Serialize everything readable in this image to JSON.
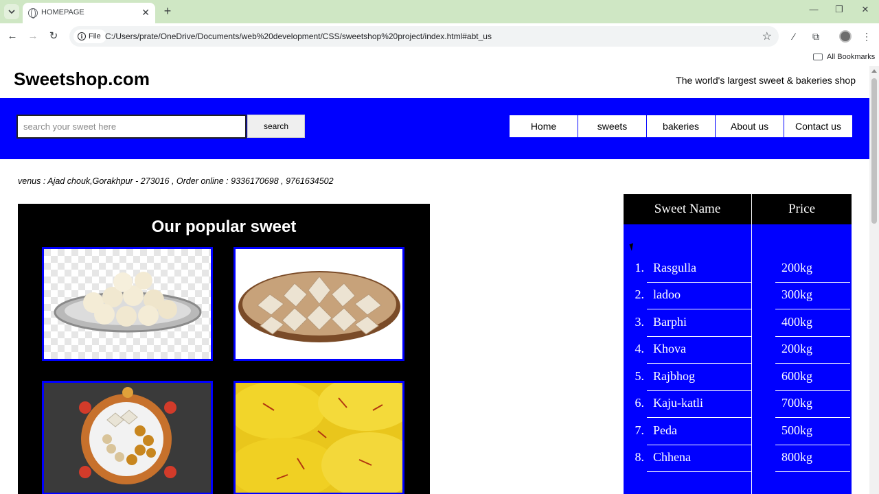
{
  "browser": {
    "tab_title": "HOMEPAGE",
    "file_chip": "File",
    "url": "C:/Users/prate/OneDrive/Documents/web%20development/CSS/sweetshop%20project/index.html#abt_us",
    "bookmarks_label": "All Bookmarks"
  },
  "header": {
    "logo": "Sweetshop.com",
    "tagline": "The world's largest sweet & bakeries shop"
  },
  "search": {
    "placeholder": "search your sweet here",
    "button_label": "search"
  },
  "nav": {
    "items": [
      "Home",
      "sweets",
      "bakeries",
      "About us",
      "Contact us"
    ]
  },
  "address": "venus : Ajad chouk,Gorakhpur - 273016 , Order online : 9336170698 , 9761634502",
  "popular": {
    "title": "Our popular sweet"
  },
  "price_table": {
    "headers": [
      "Sweet Name",
      "Price"
    ],
    "rows": [
      {
        "num": "1.",
        "name": "Rasgulla",
        "price": "200kg"
      },
      {
        "num": "2.",
        "name": "ladoo",
        "price": "300kg"
      },
      {
        "num": "3.",
        "name": "Barphi",
        "price": "400kg"
      },
      {
        "num": "4.",
        "name": "Khova",
        "price": "200kg"
      },
      {
        "num": "5.",
        "name": "Rajbhog",
        "price": "600kg"
      },
      {
        "num": "6.",
        "name": "Kaju-katli",
        "price": "700kg"
      },
      {
        "num": "7.",
        "name": "Peda",
        "price": "500kg"
      },
      {
        "num": "8.",
        "name": "Chhena",
        "price": "800kg"
      }
    ]
  },
  "colors": {
    "accent_blue": "#0000ff",
    "browser_frame": "#cfe7c4",
    "panel_black": "#000000"
  }
}
